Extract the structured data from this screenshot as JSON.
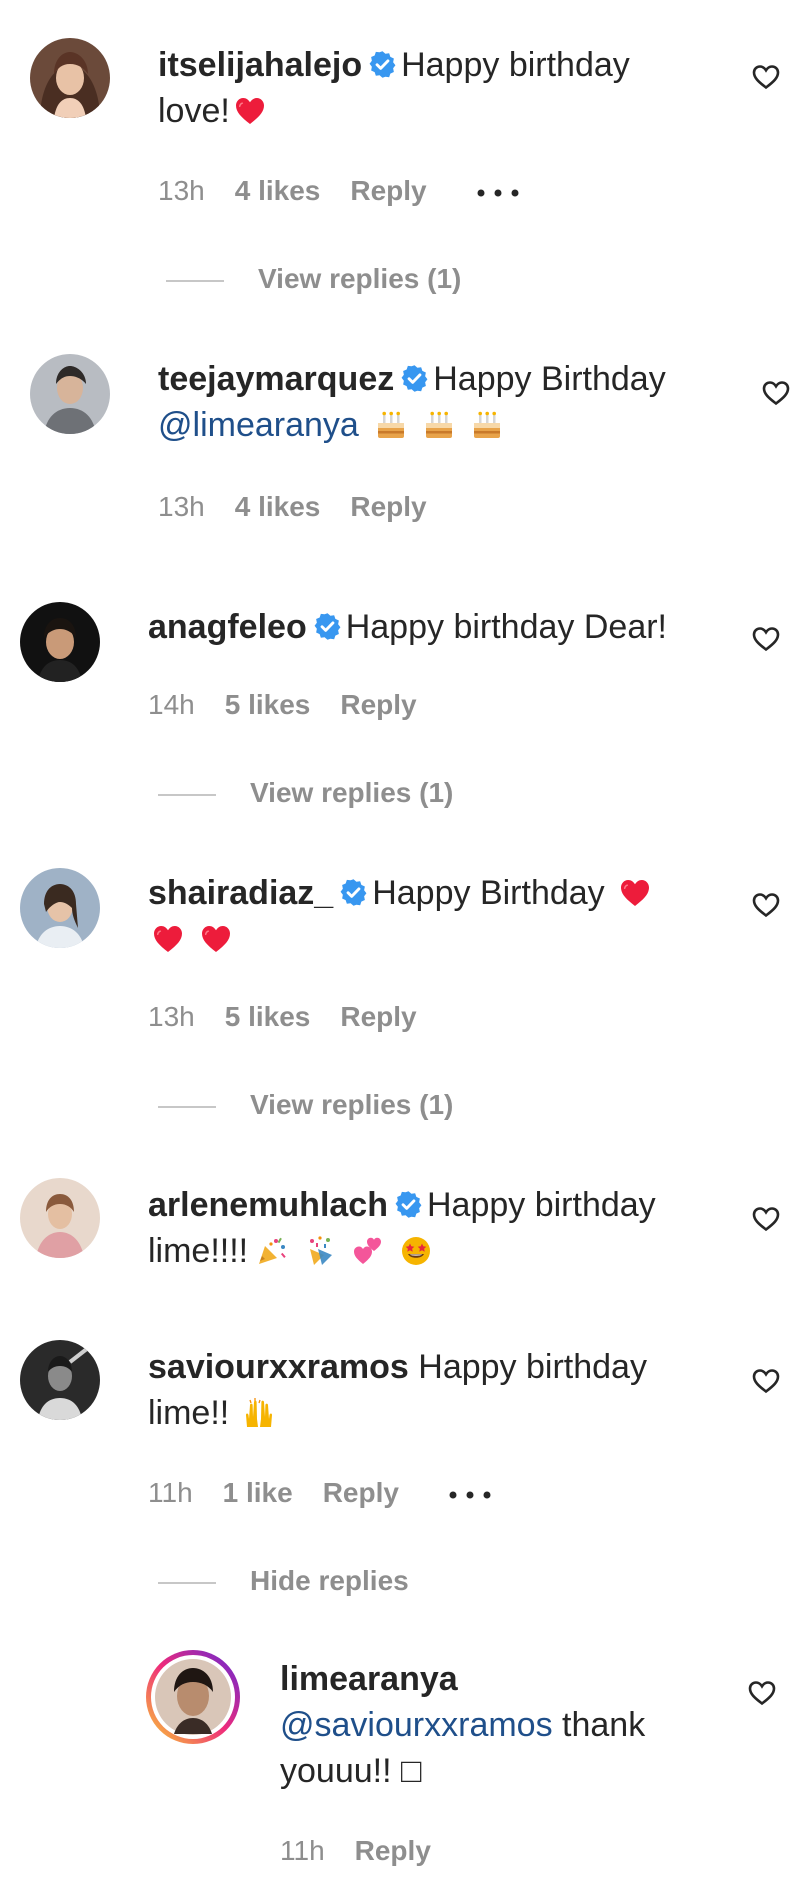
{
  "comments": [
    {
      "username": "itselijahalejo",
      "text_line1": "Happy birthday",
      "text_line2": "love!",
      "time": "13h",
      "likes": "4 likes",
      "reply": "Reply",
      "replies_toggle": "View replies (1)"
    },
    {
      "username": "teejaymarquez",
      "text_line1": "Happy Birthday",
      "mention": "@limearanya",
      "time": "13h",
      "likes": "4 likes",
      "reply": "Reply"
    },
    {
      "username": "anagfeleo",
      "text_line1": "Happy birthday Dear!",
      "time": "14h",
      "likes": "5 likes",
      "reply": "Reply",
      "replies_toggle": "View replies (1)"
    },
    {
      "username": "shairadiaz_",
      "text_line1": "Happy Birthday",
      "time": "13h",
      "likes": "5 likes",
      "reply": "Reply",
      "replies_toggle": "View replies (1)"
    },
    {
      "username": "arlenemuhlach",
      "text_line1": "Happy birthday",
      "text_line2": "lime!!!!"
    },
    {
      "username": "saviourxxramos",
      "text_line1": "Happy birthday",
      "text_line2": "lime!!",
      "time": "11h",
      "likes": "1 like",
      "reply": "Reply",
      "replies_toggle": "Hide replies"
    }
  ],
  "reply_comment": {
    "username": "limearanya",
    "mention": "@saviourxxramos",
    "text_line1_rest": "thank",
    "text_line2": "youuu!! □",
    "time": "11h",
    "reply": "Reply"
  },
  "colors": {
    "text": "#262626",
    "meta": "#8e8e8e",
    "mention": "#1f4f8a",
    "verified": "#3897f0",
    "heart_emoji": "#ed1c3b"
  }
}
